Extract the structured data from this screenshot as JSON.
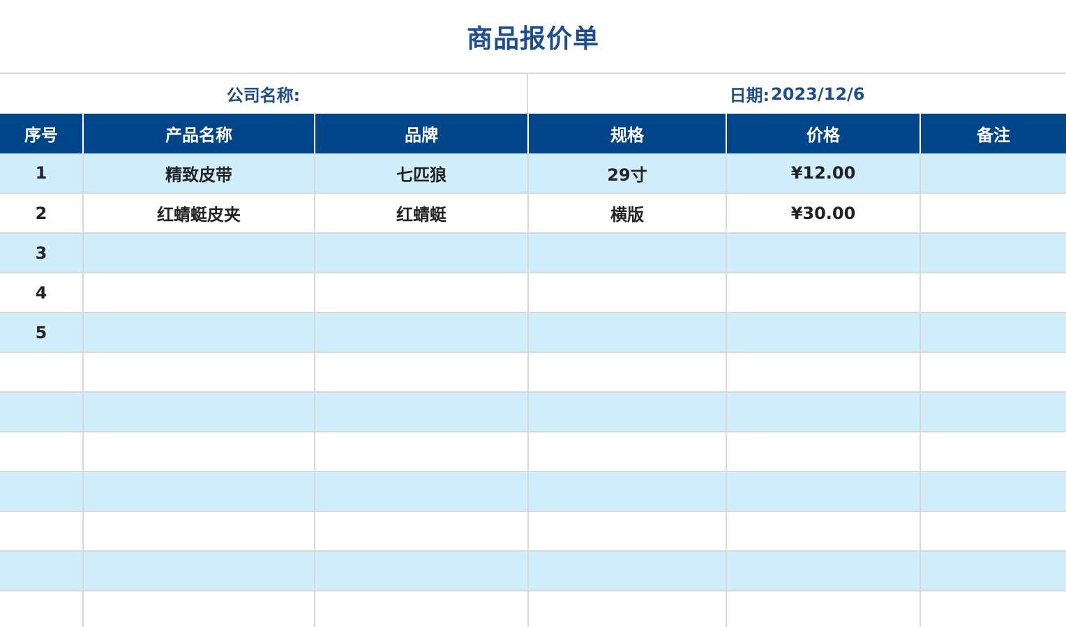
{
  "document": {
    "title": "商品报价单",
    "company_label": "公司名称:",
    "date_label": "日期:",
    "date_value": "2023/12/6"
  },
  "table": {
    "headers": [
      "序号",
      "产品名称",
      "品牌",
      "规格",
      "价格",
      "备注"
    ],
    "rows": [
      [
        "1",
        "精致皮带",
        "七匹狼",
        "29寸",
        "¥12.00",
        ""
      ],
      [
        "2",
        "红蜻蜓皮夹",
        "红蜻蜓",
        "横版",
        "¥30.00",
        ""
      ],
      [
        "3",
        "",
        "",
        "",
        "",
        ""
      ],
      [
        "4",
        "",
        "",
        "",
        "",
        ""
      ],
      [
        "5",
        "",
        "",
        "",
        "",
        ""
      ],
      [
        "",
        "",
        "",
        "",
        "",
        ""
      ],
      [
        "",
        "",
        "",
        "",
        "",
        ""
      ],
      [
        "",
        "",
        "",
        "",
        "",
        ""
      ],
      [
        "",
        "",
        "",
        "",
        "",
        ""
      ],
      [
        "",
        "",
        "",
        "",
        "",
        ""
      ],
      [
        "",
        "",
        "",
        "",
        "",
        ""
      ],
      [
        "",
        "",
        "",
        "",
        "",
        ""
      ]
    ]
  },
  "colors": {
    "header_bg": "#00458a",
    "accent_text": "#1f4e8f",
    "stripe_bg": "#d0eefc",
    "grid_line": "#d9d9d9"
  }
}
